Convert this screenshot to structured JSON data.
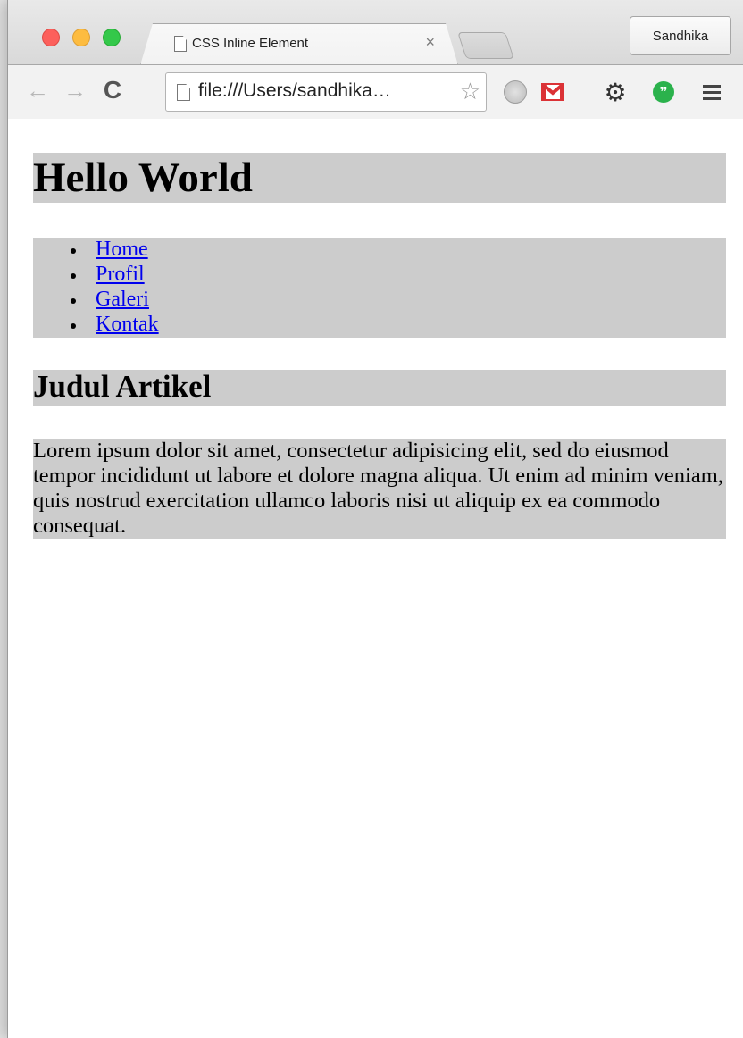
{
  "browser": {
    "tab": {
      "title": "CSS Inline Element",
      "close_glyph": "×"
    },
    "profile": "Sandhika",
    "toolbar": {
      "back_glyph": "←",
      "forward_glyph": "→",
      "reload_glyph": "C",
      "address": "file:///Users/sandhika…",
      "star_glyph": "☆",
      "extensions": [
        "stop-icon",
        "gmail-icon",
        "gear-icon",
        "hangouts-icon",
        "menu-icon"
      ]
    }
  },
  "page": {
    "heading": "Hello World",
    "nav": [
      "Home",
      "Profil",
      "Galeri",
      "Kontak"
    ],
    "article_title": "Judul Artikel",
    "paragraph": "Lorem ipsum dolor sit amet, consectetur adipisicing elit, sed do eiusmod tempor incididunt ut labore et dolore magna aliqua. Ut enim ad minim veniam, quis nostrud exercitation ullamco laboris nisi ut aliquip ex ea commodo consequat."
  },
  "colors": {
    "block_background": "#cccccc",
    "link": "#0000ee",
    "gmail_red": "#db3236",
    "hangouts_green": "#2bb24c"
  }
}
